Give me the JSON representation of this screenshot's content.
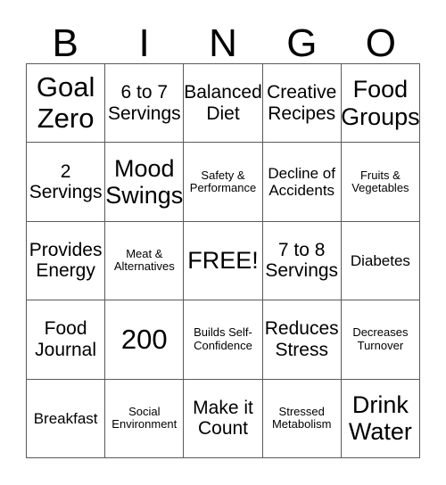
{
  "card": {
    "title": "BINGO",
    "header_letters": [
      "B",
      "I",
      "N",
      "G",
      "O"
    ],
    "rows": 5,
    "columns": 5,
    "free_space_label": "FREE!",
    "free_space_position": "row3-col3",
    "colors": {
      "background": "#ffffff",
      "text": "#000000",
      "grid_line": "#5a5a5a"
    },
    "cells": [
      {
        "text": "Goal Zero",
        "size": "xl"
      },
      {
        "text": "6 to 7 Servings",
        "size": "md"
      },
      {
        "text": "Balanced Diet",
        "size": "md"
      },
      {
        "text": "Creative Recipes",
        "size": "md"
      },
      {
        "text": "Food Groups",
        "size": "lg"
      },
      {
        "text": "2 Servings",
        "size": "md"
      },
      {
        "text": "Mood Swings",
        "size": "lg"
      },
      {
        "text": "Safety & Performance",
        "size": "xs"
      },
      {
        "text": "Decline of Accidents",
        "size": "sm"
      },
      {
        "text": "Fruits & Vegetables",
        "size": "xs"
      },
      {
        "text": "Provides Energy",
        "size": "md"
      },
      {
        "text": "Meat & Alternatives",
        "size": "xs"
      },
      {
        "text": "FREE!",
        "size": "lg"
      },
      {
        "text": "7 to 8 Servings",
        "size": "md"
      },
      {
        "text": "Diabetes",
        "size": "sm"
      },
      {
        "text": "Food Journal",
        "size": "md"
      },
      {
        "text": "200",
        "size": "xl"
      },
      {
        "text": "Builds Self-Confidence",
        "size": "xs"
      },
      {
        "text": "Reduces Stress",
        "size": "md"
      },
      {
        "text": "Decreases Turnover",
        "size": "xs"
      },
      {
        "text": "Breakfast",
        "size": "sm"
      },
      {
        "text": "Social Environment",
        "size": "xs"
      },
      {
        "text": "Make it Count",
        "size": "md"
      },
      {
        "text": "Stressed Metabolism",
        "size": "xs"
      },
      {
        "text": "Drink Water",
        "size": "lg"
      }
    ]
  }
}
